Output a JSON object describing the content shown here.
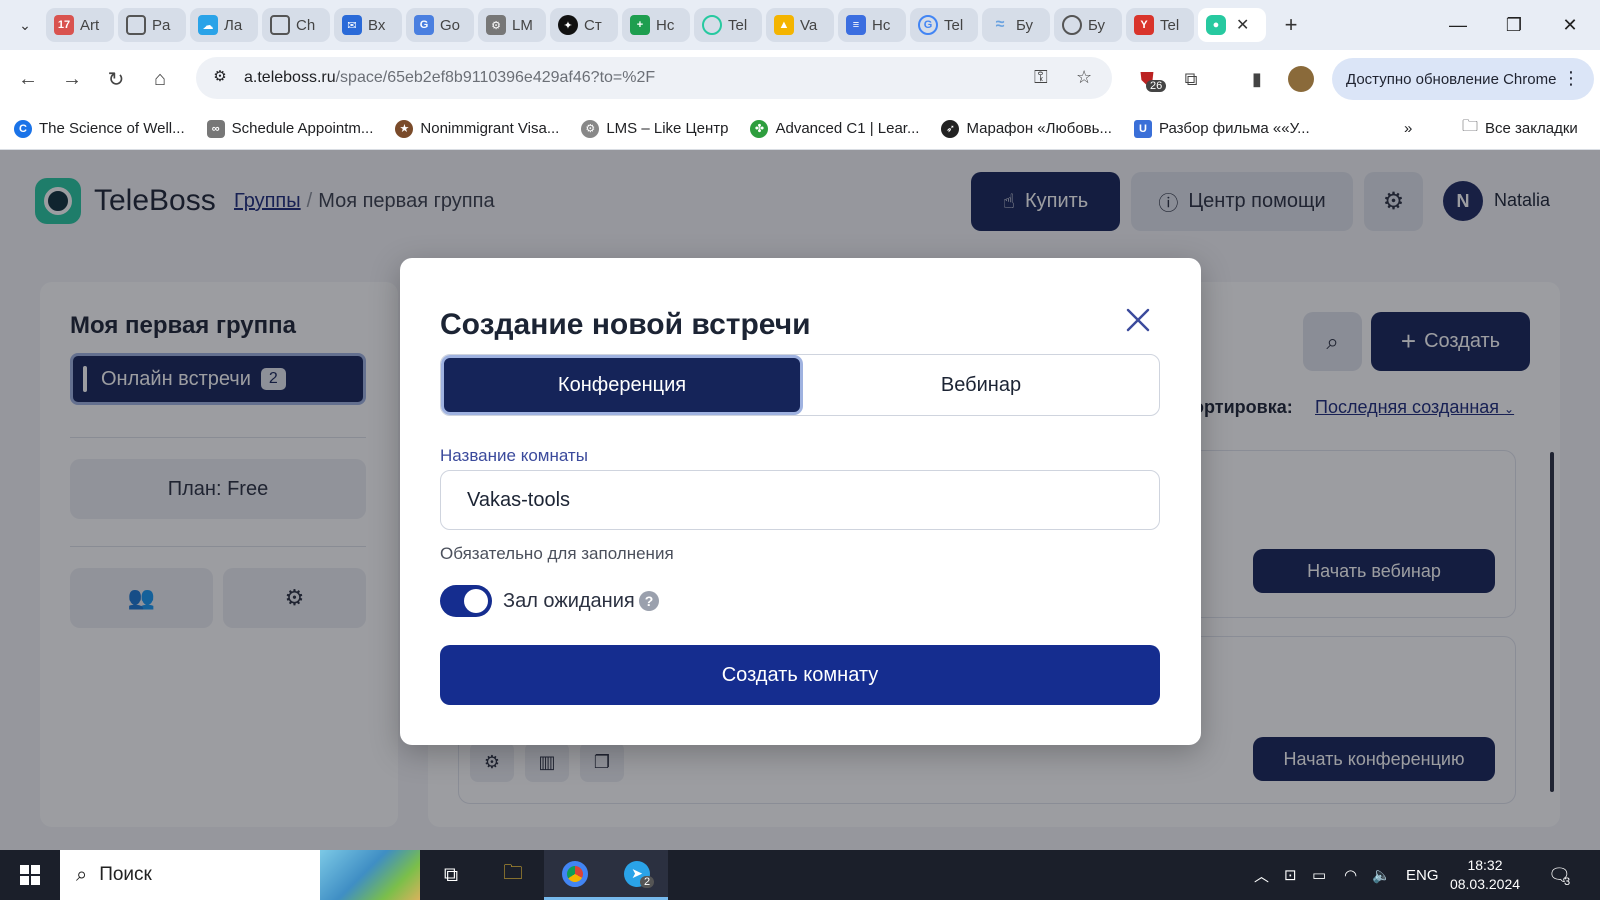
{
  "browser": {
    "tabs": [
      {
        "label": "Art",
        "icon": "calendar-favicon",
        "color": "#d9534f"
      },
      {
        "label": "Pa",
        "icon": "spinner-favicon",
        "color": "#555555"
      },
      {
        "label": "Ла",
        "icon": "cloud-favicon",
        "color": "#2aa3e8"
      },
      {
        "label": "Ch",
        "icon": "openai-favicon",
        "color": "#555555"
      },
      {
        "label": "Вх",
        "icon": "mail-favicon",
        "color": "#2a6ad8"
      },
      {
        "label": "Go",
        "icon": "translate-favicon",
        "color": "#4a7fe0"
      },
      {
        "label": "LM",
        "icon": "lms-favicon",
        "color": "#777777"
      },
      {
        "label": "Ст",
        "icon": "star-favicon",
        "color": "#111111"
      },
      {
        "label": "Нс",
        "icon": "sheets-favicon",
        "color": "#1e9e4f"
      },
      {
        "label": "Tel",
        "icon": "teleboss-favicon",
        "color": "#27c9a0"
      },
      {
        "label": "Va",
        "icon": "drive-favicon",
        "color": "#f4b400"
      },
      {
        "label": "Нс",
        "icon": "docs-favicon",
        "color": "#3b6ee0"
      },
      {
        "label": "Tel",
        "icon": "google-favicon",
        "color": "#4285f4"
      },
      {
        "label": "Бу",
        "icon": "wind-favicon",
        "color": "#6aa2e0"
      },
      {
        "label": "Бу",
        "icon": "globe-favicon",
        "color": "#555555"
      },
      {
        "label": "Tel",
        "icon": "yandex-favicon",
        "color": "#d9342b"
      }
    ],
    "active_tab_close": "✕",
    "new_tab": "+",
    "url_host": "a.teleboss.ru",
    "url_path": "/space/65eb2ef8b9110396e429af46?to=%2F",
    "extension_badge": "26",
    "update_label": "Доступно обновление Chrome",
    "bookmarks": [
      {
        "label": "The Science of Well...",
        "icon": "c-icon",
        "color": "#1a73e8"
      },
      {
        "label": "Schedule Appointm...",
        "icon": "go-icon",
        "color": "#777777"
      },
      {
        "label": "Nonimmigrant Visa...",
        "icon": "seal-icon",
        "color": "#7a4b2a"
      },
      {
        "label": "LMS – Like Центр",
        "icon": "gear-logo-icon",
        "color": "#888888"
      },
      {
        "label": "Advanced C1 | Lear...",
        "icon": "clover-icon",
        "color": "#2e9e3e"
      },
      {
        "label": "Марафон «Любовь...",
        "icon": "bird-icon",
        "color": "#222222"
      },
      {
        "label": "Разбор фильма ««У...",
        "icon": "u-icon",
        "color": "#3a6fd8"
      }
    ],
    "bookmarks_more": "»",
    "all_bookmarks": "Все закладки"
  },
  "app": {
    "brand": "TeleBoss",
    "breadcrumb_link": "Группы",
    "breadcrumb_sep": "/",
    "breadcrumb_current": "Моя первая группа",
    "buy_label": "Купить",
    "help_label": "Центр помощи",
    "avatar_letter": "N",
    "username": "Natalia",
    "sidebar": {
      "title": "Моя первая группа",
      "active_item": "Онлайн встречи",
      "active_badge": "2",
      "plan": "План: Free"
    },
    "main": {
      "create_label": "Создать",
      "sort_label": "Сортировка:",
      "sort_value": "Последняя созданная",
      "room1_action": "Начать вебинар",
      "room2_action": "Начать конференцию"
    }
  },
  "modal": {
    "title": "Создание новой встречи",
    "tabs": [
      "Конференция",
      "Вебинар"
    ],
    "active_tab": 0,
    "field_label": "Название комнаты",
    "field_value": "Vakas-tools",
    "field_hint": "Обязательно для заполнения",
    "waiting_room_label": "Зал ожидания",
    "waiting_room_enabled": true,
    "help_glyph": "?",
    "submit_label": "Создать комнату"
  },
  "taskbar": {
    "search_label": "Поиск",
    "language": "ENG",
    "time": "18:32",
    "date": "08.03.2024",
    "telegram_badge": "2",
    "notification_count": "3"
  },
  "colors": {
    "primary_dark": "#152459",
    "primary": "#152d8f",
    "accent_teal": "#27c9a0"
  }
}
